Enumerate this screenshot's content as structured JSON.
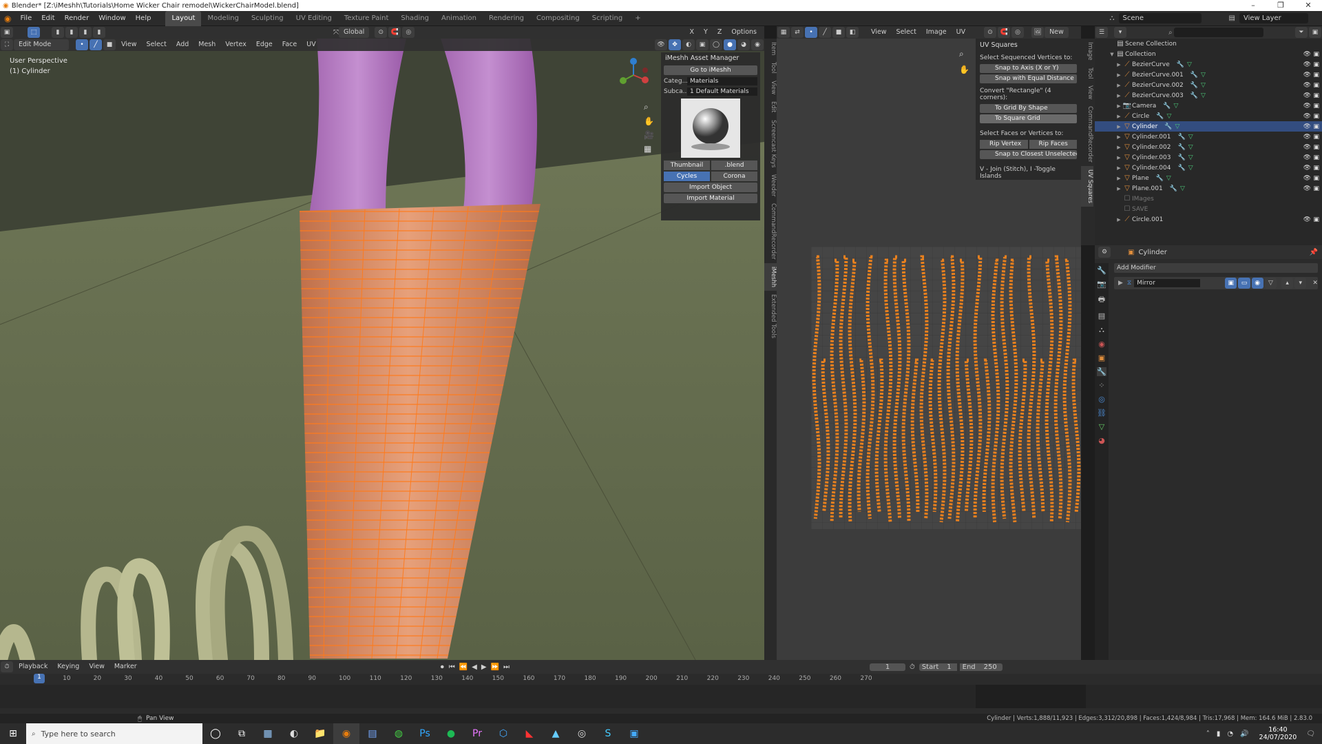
{
  "titlebar": {
    "title": "Blender* [Z:\\iMeshh\\Tutorials\\Home Wicker Chair remodel\\WickerChairModel.blend]"
  },
  "menu": [
    "File",
    "Edit",
    "Render",
    "Window",
    "Help"
  ],
  "workspaces": [
    "Layout",
    "Modeling",
    "Sculpting",
    "UV Editing",
    "Texture Paint",
    "Shading",
    "Animation",
    "Rendering",
    "Compositing",
    "Scripting"
  ],
  "active_workspace": "Layout",
  "scene": "Scene",
  "view_layer": "View Layer",
  "viewport": {
    "mode": "Edit Mode",
    "header_menus": [
      "View",
      "Select",
      "Add",
      "Mesh",
      "Vertex",
      "Edge",
      "Face",
      "UV"
    ],
    "transform_orientation": "Global",
    "options_label": "Options",
    "overlay_text": "User Perspective",
    "object_label": "(1) Cylinder",
    "axes": [
      "X",
      "Y",
      "Z"
    ]
  },
  "asset_manager": {
    "title": "iMeshh Asset Manager",
    "go_button": "Go to iMeshh",
    "category_label": "Categ...",
    "category_value": "Materials",
    "subcategory_label": "Subca...",
    "subcategory_value": "1 Default Materials",
    "thumbnail_tab": "Thumbnail",
    "blend_tab": ".blend",
    "cycles_tab": "Cycles",
    "corona_tab": "Corona",
    "import_object": "Import Object",
    "import_material": "Import Material"
  },
  "uv_editor": {
    "header_menus": [
      "View",
      "Select",
      "Image",
      "UV"
    ],
    "new_button": "New"
  },
  "uv_squares": {
    "title": "UV Squares",
    "label_seq": "Select Sequenced Vertices to:",
    "snap_axis": "Snap to Axis (X or Y)",
    "snap_equal": "Snap with Equal Distance",
    "label_rect": "Convert \"Rectangle\" (4 corners):",
    "to_grid": "To Grid By Shape",
    "to_square": "To Square Grid",
    "label_faces": "Select Faces or Vertices to:",
    "rip_vertex": "Rip Vertex",
    "rip_faces": "Rip Faces",
    "snap_closest": "Snap to Closest Unselected",
    "hint": "V - Join (Stitch), I -Toggle Islands"
  },
  "side_tabs_viewport": [
    "Item",
    "Tool",
    "View",
    "Edit",
    "Screencast Keys",
    "Weeder",
    "CommandRecorder",
    "iMeshh",
    "Extended Tools"
  ],
  "side_tabs_uv": [
    "Image",
    "Tool",
    "View",
    "CommandRecorder",
    "UV Squares"
  ],
  "outliner": {
    "root": "Scene Collection",
    "collection": "Collection",
    "items": [
      {
        "name": "BezierCurve",
        "icon": "curve-icon",
        "selected": false
      },
      {
        "name": "BezierCurve.001",
        "icon": "curve-icon",
        "selected": false
      },
      {
        "name": "BezierCurve.002",
        "icon": "curve-icon",
        "selected": false
      },
      {
        "name": "BezierCurve.003",
        "icon": "curve-icon",
        "selected": false
      },
      {
        "name": "Camera",
        "icon": "camera-icon",
        "selected": false
      },
      {
        "name": "Circle",
        "icon": "curve-icon",
        "selected": false
      },
      {
        "name": "Cylinder",
        "icon": "mesh-icon",
        "selected": true
      },
      {
        "name": "Cylinder.001",
        "icon": "mesh-icon",
        "selected": false
      },
      {
        "name": "Cylinder.002",
        "icon": "mesh-icon",
        "selected": false
      },
      {
        "name": "Cylinder.003",
        "icon": "mesh-icon",
        "selected": false
      },
      {
        "name": "Cylinder.004",
        "icon": "mesh-icon",
        "selected": false
      },
      {
        "name": "Plane",
        "icon": "mesh-icon",
        "selected": false
      },
      {
        "name": "Plane.001",
        "icon": "mesh-icon",
        "selected": false
      }
    ],
    "disabled": [
      "IMages",
      "SAVE"
    ],
    "last": "Circle.001"
  },
  "properties": {
    "object": "Cylinder",
    "add_modifier": "Add Modifier",
    "modifier": "Mirror"
  },
  "timeline": {
    "menus": [
      "Playback",
      "Keying",
      "View",
      "Marker"
    ],
    "current_frame": "1",
    "start_label": "Start",
    "start": "1",
    "end_label": "End",
    "end": "250",
    "ticks": [
      "1",
      "10",
      "20",
      "30",
      "40",
      "50",
      "60",
      "70",
      "80",
      "90",
      "100",
      "110",
      "120",
      "130",
      "140",
      "150",
      "160",
      "170",
      "180",
      "190",
      "200",
      "210",
      "220",
      "230",
      "240",
      "250",
      "260",
      "270"
    ]
  },
  "status": {
    "left": "Pan View",
    "right": "Cylinder | Verts:1,888/11,923 | Edges:3,312/20,898 | Faces:1,424/8,984 | Tris:17,968 | Mem: 164.6 MiB | 2.83.0"
  },
  "taskbar": {
    "search_placeholder": "Type here to search",
    "time": "16:40",
    "date": "24/07/2020"
  },
  "colors": {
    "accent": "#4772b3",
    "selection": "#e8801e",
    "mesh": "#d08a5c",
    "floor": "#5d6648"
  }
}
